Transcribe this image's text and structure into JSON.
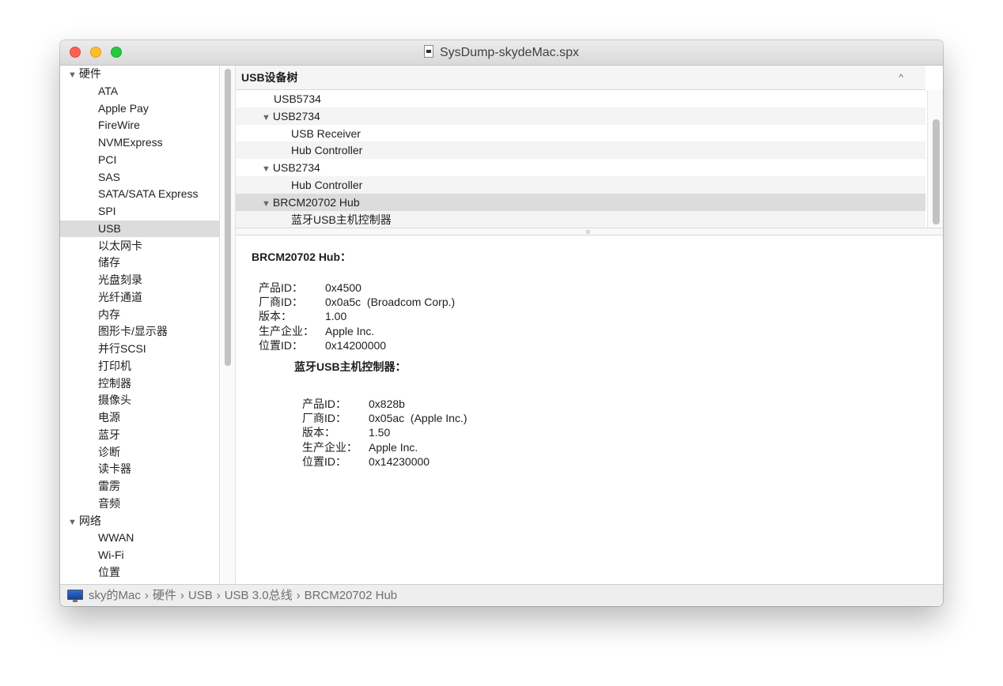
{
  "window": {
    "title": "SysDump-skydeMac.spx"
  },
  "sidebar": {
    "items": [
      {
        "label": "硬件",
        "kind": "group",
        "expanded": true
      },
      {
        "label": "ATA",
        "kind": "child"
      },
      {
        "label": "Apple Pay",
        "kind": "child"
      },
      {
        "label": "FireWire",
        "kind": "child"
      },
      {
        "label": "NVMExpress",
        "kind": "child"
      },
      {
        "label": "PCI",
        "kind": "child"
      },
      {
        "label": "SAS",
        "kind": "child"
      },
      {
        "label": "SATA/SATA Express",
        "kind": "child"
      },
      {
        "label": "SPI",
        "kind": "child"
      },
      {
        "label": "USB",
        "kind": "child",
        "selected": true
      },
      {
        "label": "以太网卡",
        "kind": "child"
      },
      {
        "label": "储存",
        "kind": "child"
      },
      {
        "label": "光盘刻录",
        "kind": "child"
      },
      {
        "label": "光纤通道",
        "kind": "child"
      },
      {
        "label": "内存",
        "kind": "child"
      },
      {
        "label": "图形卡/显示器",
        "kind": "child"
      },
      {
        "label": "并行SCSI",
        "kind": "child"
      },
      {
        "label": "打印机",
        "kind": "child"
      },
      {
        "label": "控制器",
        "kind": "child"
      },
      {
        "label": "摄像头",
        "kind": "child"
      },
      {
        "label": "电源",
        "kind": "child"
      },
      {
        "label": "蓝牙",
        "kind": "child"
      },
      {
        "label": "诊断",
        "kind": "child"
      },
      {
        "label": "读卡器",
        "kind": "child"
      },
      {
        "label": "雷雳",
        "kind": "child"
      },
      {
        "label": "音频",
        "kind": "child"
      },
      {
        "label": "网络",
        "kind": "group",
        "expanded": true
      },
      {
        "label": "WWAN",
        "kind": "child"
      },
      {
        "label": "Wi-Fi",
        "kind": "child"
      },
      {
        "label": "位置",
        "kind": "child"
      }
    ]
  },
  "tree": {
    "header": "USB设备树",
    "rows": [
      {
        "label": "USB5734",
        "level": "l1plain"
      },
      {
        "label": "USB2734",
        "level": "l1",
        "expanded": true
      },
      {
        "label": "USB Receiver",
        "level": "l2"
      },
      {
        "label": "Hub Controller",
        "level": "l2"
      },
      {
        "label": "USB2734",
        "level": "l1",
        "expanded": true
      },
      {
        "label": "Hub Controller",
        "level": "l2"
      },
      {
        "label": "BRCM20702 Hub",
        "level": "l1",
        "expanded": true,
        "selected": true
      },
      {
        "label": "蓝牙USB主机控制器",
        "level": "l2"
      }
    ]
  },
  "detail": {
    "title": "BRCM20702 Hub：",
    "props": [
      {
        "key": "产品ID：",
        "value": "0x4500"
      },
      {
        "key": "厂商ID：",
        "value": "0x0a5c  (Broadcom Corp.)"
      },
      {
        "key": "版本：",
        "value": "1.00"
      },
      {
        "key": "生产企业：",
        "value": "Apple Inc."
      },
      {
        "key": "位置ID：",
        "value": "0x14200000"
      }
    ],
    "sub_title": "蓝牙USB主机控制器：",
    "sub_props": [
      {
        "key": "产品ID：",
        "value": "0x828b"
      },
      {
        "key": "厂商ID：",
        "value": "0x05ac  (Apple Inc.)"
      },
      {
        "key": "版本：",
        "value": "1.50"
      },
      {
        "key": "生产企业：",
        "value": "Apple Inc."
      },
      {
        "key": "位置ID：",
        "value": "0x14230000"
      }
    ]
  },
  "statusbar": {
    "icon": "imac-icon",
    "crumbs": [
      "sky的Mac",
      "硬件",
      "USB",
      "USB 3.0总线",
      "BRCM20702 Hub"
    ],
    "separator": "›"
  }
}
